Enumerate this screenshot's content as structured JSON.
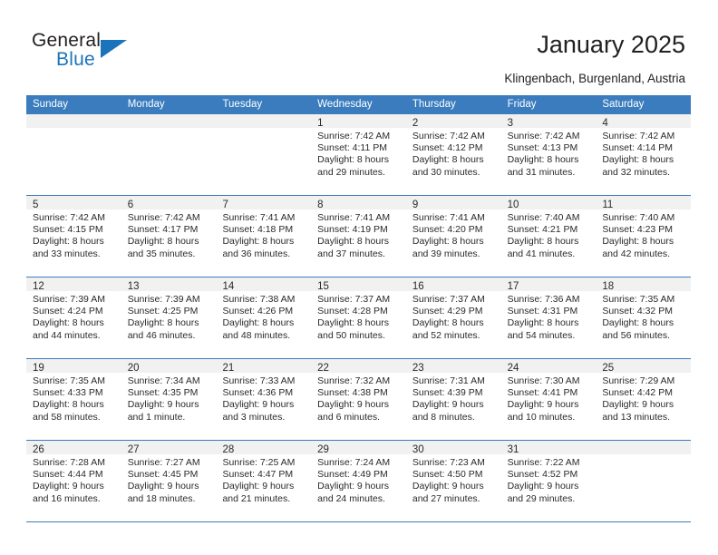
{
  "brand": {
    "name_top": "General",
    "name_bottom": "Blue",
    "accent_color": "#1b74bb"
  },
  "header": {
    "title": "January 2025",
    "subtitle": "Klingenbach, Burgenland, Austria"
  },
  "theme": {
    "header_blue": "#3a7cbe",
    "daynum_band": "#f1f1f1",
    "text": "#2a2a2a"
  },
  "weekdays": [
    "Sunday",
    "Monday",
    "Tuesday",
    "Wednesday",
    "Thursday",
    "Friday",
    "Saturday"
  ],
  "weeks": [
    [
      {
        "empty": true
      },
      {
        "empty": true
      },
      {
        "empty": true
      },
      {
        "day": "1",
        "sunrise": "Sunrise: 7:42 AM",
        "sunset": "Sunset: 4:11 PM",
        "daylight_line1": "Daylight: 8 hours",
        "daylight_line2": "and 29 minutes."
      },
      {
        "day": "2",
        "sunrise": "Sunrise: 7:42 AM",
        "sunset": "Sunset: 4:12 PM",
        "daylight_line1": "Daylight: 8 hours",
        "daylight_line2": "and 30 minutes."
      },
      {
        "day": "3",
        "sunrise": "Sunrise: 7:42 AM",
        "sunset": "Sunset: 4:13 PM",
        "daylight_line1": "Daylight: 8 hours",
        "daylight_line2": "and 31 minutes."
      },
      {
        "day": "4",
        "sunrise": "Sunrise: 7:42 AM",
        "sunset": "Sunset: 4:14 PM",
        "daylight_line1": "Daylight: 8 hours",
        "daylight_line2": "and 32 minutes."
      }
    ],
    [
      {
        "day": "5",
        "sunrise": "Sunrise: 7:42 AM",
        "sunset": "Sunset: 4:15 PM",
        "daylight_line1": "Daylight: 8 hours",
        "daylight_line2": "and 33 minutes."
      },
      {
        "day": "6",
        "sunrise": "Sunrise: 7:42 AM",
        "sunset": "Sunset: 4:17 PM",
        "daylight_line1": "Daylight: 8 hours",
        "daylight_line2": "and 35 minutes."
      },
      {
        "day": "7",
        "sunrise": "Sunrise: 7:41 AM",
        "sunset": "Sunset: 4:18 PM",
        "daylight_line1": "Daylight: 8 hours",
        "daylight_line2": "and 36 minutes."
      },
      {
        "day": "8",
        "sunrise": "Sunrise: 7:41 AM",
        "sunset": "Sunset: 4:19 PM",
        "daylight_line1": "Daylight: 8 hours",
        "daylight_line2": "and 37 minutes."
      },
      {
        "day": "9",
        "sunrise": "Sunrise: 7:41 AM",
        "sunset": "Sunset: 4:20 PM",
        "daylight_line1": "Daylight: 8 hours",
        "daylight_line2": "and 39 minutes."
      },
      {
        "day": "10",
        "sunrise": "Sunrise: 7:40 AM",
        "sunset": "Sunset: 4:21 PM",
        "daylight_line1": "Daylight: 8 hours",
        "daylight_line2": "and 41 minutes."
      },
      {
        "day": "11",
        "sunrise": "Sunrise: 7:40 AM",
        "sunset": "Sunset: 4:23 PM",
        "daylight_line1": "Daylight: 8 hours",
        "daylight_line2": "and 42 minutes."
      }
    ],
    [
      {
        "day": "12",
        "sunrise": "Sunrise: 7:39 AM",
        "sunset": "Sunset: 4:24 PM",
        "daylight_line1": "Daylight: 8 hours",
        "daylight_line2": "and 44 minutes."
      },
      {
        "day": "13",
        "sunrise": "Sunrise: 7:39 AM",
        "sunset": "Sunset: 4:25 PM",
        "daylight_line1": "Daylight: 8 hours",
        "daylight_line2": "and 46 minutes."
      },
      {
        "day": "14",
        "sunrise": "Sunrise: 7:38 AM",
        "sunset": "Sunset: 4:26 PM",
        "daylight_line1": "Daylight: 8 hours",
        "daylight_line2": "and 48 minutes."
      },
      {
        "day": "15",
        "sunrise": "Sunrise: 7:37 AM",
        "sunset": "Sunset: 4:28 PM",
        "daylight_line1": "Daylight: 8 hours",
        "daylight_line2": "and 50 minutes."
      },
      {
        "day": "16",
        "sunrise": "Sunrise: 7:37 AM",
        "sunset": "Sunset: 4:29 PM",
        "daylight_line1": "Daylight: 8 hours",
        "daylight_line2": "and 52 minutes."
      },
      {
        "day": "17",
        "sunrise": "Sunrise: 7:36 AM",
        "sunset": "Sunset: 4:31 PM",
        "daylight_line1": "Daylight: 8 hours",
        "daylight_line2": "and 54 minutes."
      },
      {
        "day": "18",
        "sunrise": "Sunrise: 7:35 AM",
        "sunset": "Sunset: 4:32 PM",
        "daylight_line1": "Daylight: 8 hours",
        "daylight_line2": "and 56 minutes."
      }
    ],
    [
      {
        "day": "19",
        "sunrise": "Sunrise: 7:35 AM",
        "sunset": "Sunset: 4:33 PM",
        "daylight_line1": "Daylight: 8 hours",
        "daylight_line2": "and 58 minutes."
      },
      {
        "day": "20",
        "sunrise": "Sunrise: 7:34 AM",
        "sunset": "Sunset: 4:35 PM",
        "daylight_line1": "Daylight: 9 hours",
        "daylight_line2": "and 1 minute."
      },
      {
        "day": "21",
        "sunrise": "Sunrise: 7:33 AM",
        "sunset": "Sunset: 4:36 PM",
        "daylight_line1": "Daylight: 9 hours",
        "daylight_line2": "and 3 minutes."
      },
      {
        "day": "22",
        "sunrise": "Sunrise: 7:32 AM",
        "sunset": "Sunset: 4:38 PM",
        "daylight_line1": "Daylight: 9 hours",
        "daylight_line2": "and 6 minutes."
      },
      {
        "day": "23",
        "sunrise": "Sunrise: 7:31 AM",
        "sunset": "Sunset: 4:39 PM",
        "daylight_line1": "Daylight: 9 hours",
        "daylight_line2": "and 8 minutes."
      },
      {
        "day": "24",
        "sunrise": "Sunrise: 7:30 AM",
        "sunset": "Sunset: 4:41 PM",
        "daylight_line1": "Daylight: 9 hours",
        "daylight_line2": "and 10 minutes."
      },
      {
        "day": "25",
        "sunrise": "Sunrise: 7:29 AM",
        "sunset": "Sunset: 4:42 PM",
        "daylight_line1": "Daylight: 9 hours",
        "daylight_line2": "and 13 minutes."
      }
    ],
    [
      {
        "day": "26",
        "sunrise": "Sunrise: 7:28 AM",
        "sunset": "Sunset: 4:44 PM",
        "daylight_line1": "Daylight: 9 hours",
        "daylight_line2": "and 16 minutes."
      },
      {
        "day": "27",
        "sunrise": "Sunrise: 7:27 AM",
        "sunset": "Sunset: 4:45 PM",
        "daylight_line1": "Daylight: 9 hours",
        "daylight_line2": "and 18 minutes."
      },
      {
        "day": "28",
        "sunrise": "Sunrise: 7:25 AM",
        "sunset": "Sunset: 4:47 PM",
        "daylight_line1": "Daylight: 9 hours",
        "daylight_line2": "and 21 minutes."
      },
      {
        "day": "29",
        "sunrise": "Sunrise: 7:24 AM",
        "sunset": "Sunset: 4:49 PM",
        "daylight_line1": "Daylight: 9 hours",
        "daylight_line2": "and 24 minutes."
      },
      {
        "day": "30",
        "sunrise": "Sunrise: 7:23 AM",
        "sunset": "Sunset: 4:50 PM",
        "daylight_line1": "Daylight: 9 hours",
        "daylight_line2": "and 27 minutes."
      },
      {
        "day": "31",
        "sunrise": "Sunrise: 7:22 AM",
        "sunset": "Sunset: 4:52 PM",
        "daylight_line1": "Daylight: 9 hours",
        "daylight_line2": "and 29 minutes."
      },
      {
        "empty": true
      }
    ]
  ]
}
